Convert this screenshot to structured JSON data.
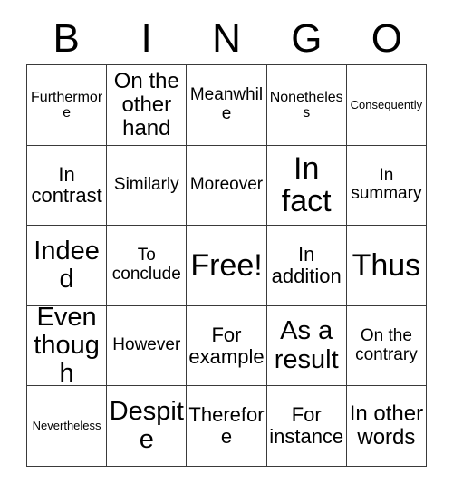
{
  "card": {
    "title_letters": [
      "B",
      "I",
      "N",
      "G",
      "O"
    ],
    "colors": {
      "background": "#ffffff",
      "border": "#3a3a3a",
      "text": "#000000"
    },
    "grid": {
      "columns": 5,
      "rows": 5,
      "free_space": "Free!",
      "free_space_position": {
        "row": 3,
        "column": 3
      }
    },
    "cells": [
      [
        {
          "text": "Furthermore",
          "size": "fs-s"
        },
        {
          "text": "On the other hand",
          "size": "fs-xl"
        },
        {
          "text": "Meanwhile",
          "size": "fs-m"
        },
        {
          "text": "Nonetheless",
          "size": "fs-s"
        },
        {
          "text": "Consequently",
          "size": "fs-xs"
        }
      ],
      [
        {
          "text": "In contrast",
          "size": "fs-l"
        },
        {
          "text": "Similarly",
          "size": "fs-m"
        },
        {
          "text": "Moreover",
          "size": "fs-m"
        },
        {
          "text": "In fact",
          "size": "fs-huge"
        },
        {
          "text": "In summary",
          "size": "fs-m"
        }
      ],
      [
        {
          "text": "Indeed",
          "size": "fs-xxl"
        },
        {
          "text": "To conclude",
          "size": "fs-m"
        },
        {
          "text": "Free!",
          "size": "fs-huge"
        },
        {
          "text": "In addition",
          "size": "fs-l"
        },
        {
          "text": "Thus",
          "size": "fs-huge"
        }
      ],
      [
        {
          "text": "Even though",
          "size": "fs-xxl"
        },
        {
          "text": "However",
          "size": "fs-m"
        },
        {
          "text": "For example",
          "size": "fs-l"
        },
        {
          "text": "As a result",
          "size": "fs-xxl"
        },
        {
          "text": "On the contrary",
          "size": "fs-m"
        }
      ],
      [
        {
          "text": "Nevertheless",
          "size": "fs-xs"
        },
        {
          "text": "Despite",
          "size": "fs-xxl"
        },
        {
          "text": "Therefore",
          "size": "fs-l"
        },
        {
          "text": "For instance",
          "size": "fs-l"
        },
        {
          "text": "In other words",
          "size": "fs-xl"
        }
      ]
    ]
  }
}
